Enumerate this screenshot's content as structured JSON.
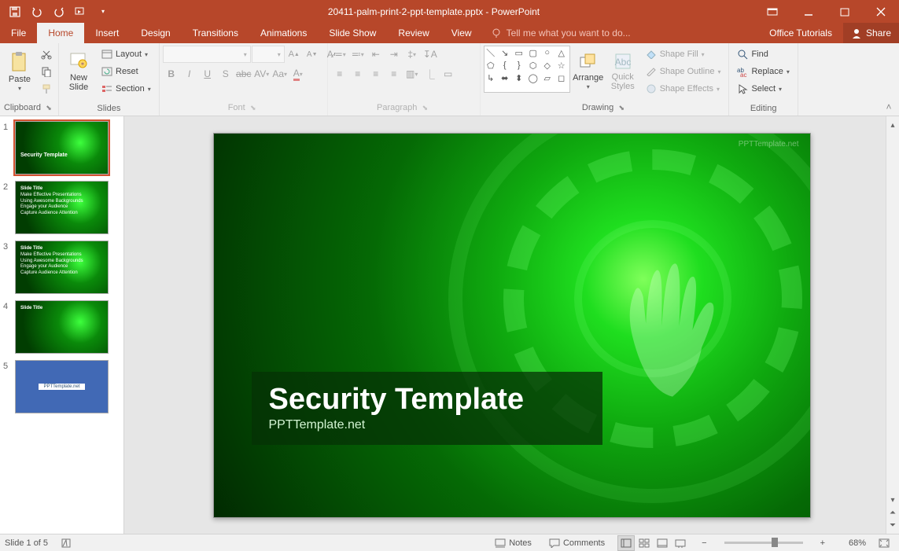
{
  "app": {
    "filename": "20411-palm-print-2-ppt-template.pptx",
    "appname": "PowerPoint"
  },
  "tabs": {
    "file": "File",
    "home": "Home",
    "insert": "Insert",
    "design": "Design",
    "transitions": "Transitions",
    "animations": "Animations",
    "slideshow": "Slide Show",
    "review": "Review",
    "view": "View",
    "tellme": "Tell me what you want to do...",
    "office_tutorials": "Office Tutorials",
    "share": "Share"
  },
  "ribbon": {
    "clipboard": {
      "label": "Clipboard",
      "paste": "Paste"
    },
    "slides": {
      "label": "Slides",
      "new_slide": "New\nSlide",
      "layout": "Layout",
      "reset": "Reset",
      "section": "Section"
    },
    "font": {
      "label": "Font"
    },
    "paragraph": {
      "label": "Paragraph"
    },
    "drawing": {
      "label": "Drawing",
      "arrange": "Arrange",
      "quick_styles": "Quick\nStyles",
      "shape_fill": "Shape Fill",
      "shape_outline": "Shape Outline",
      "shape_effects": "Shape Effects"
    },
    "editing": {
      "label": "Editing",
      "find": "Find",
      "replace": "Replace",
      "select": "Select"
    }
  },
  "thumbnails": {
    "count": 5,
    "slide1_title": "Security Template",
    "slide2_title": "Slide Title",
    "slide2_bullets": [
      "Make Effective Presentations",
      "Using Awesome Backgrounds",
      "Engage your Audience",
      "Capture Audience Attention"
    ],
    "slide3_title": "Slide Title",
    "slide4_title": "Slide Title",
    "slide5_title": "PPTTemplate.net"
  },
  "slide": {
    "title": "Security Template",
    "subtitle": "PPTTemplate.net",
    "watermark": "PPTTemplate.net"
  },
  "status": {
    "slide_info": "Slide 1 of 5",
    "notes": "Notes",
    "comments": "Comments",
    "zoom": "68%"
  }
}
